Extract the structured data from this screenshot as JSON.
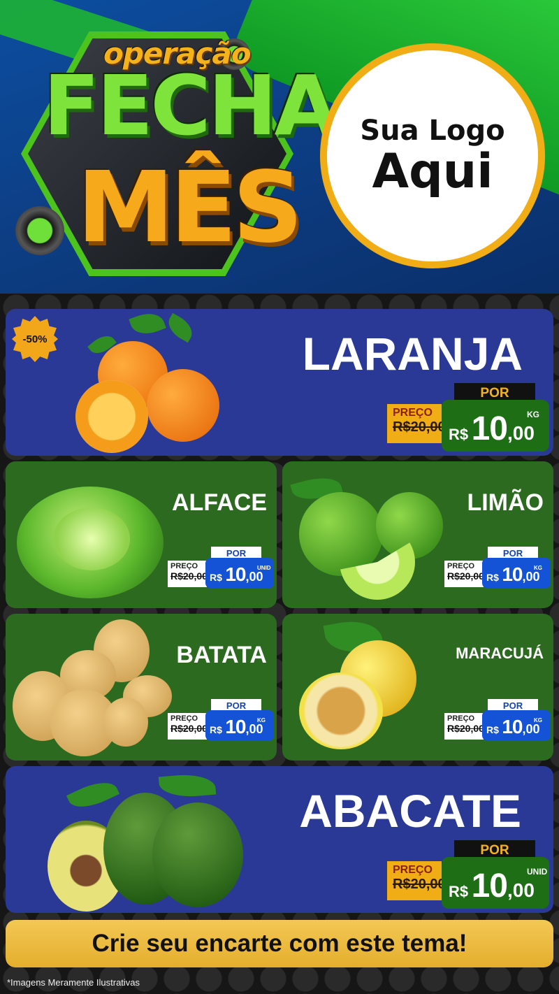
{
  "header": {
    "title_small": "operação",
    "title_line1": "FECHA",
    "title_line2": "MÊS",
    "logo_line1": "Sua Logo",
    "logo_line2": "Aqui"
  },
  "colors": {
    "blue_card": "#2a3896",
    "green_card": "#2c6a20",
    "gold": "#f1ad16",
    "price_blue": "#1453d6"
  },
  "discount_badge": "-50%",
  "products": {
    "laranja": {
      "name": "LARANJA",
      "por": "POR",
      "preco_label": "PREÇO",
      "old_price": "R$20,00",
      "currency": "R$",
      "price_int": "10",
      "price_cents": ",00",
      "unit": "KG"
    },
    "alface": {
      "name": "ALFACE",
      "por": "POR",
      "preco_label": "PREÇO",
      "old_price": "R$20,00",
      "currency": "R$",
      "price_int": "10",
      "price_cents": ",00",
      "unit": "UNID"
    },
    "limao": {
      "name": "LIMÃO",
      "por": "POR",
      "preco_label": "PREÇO",
      "old_price": "R$20,00",
      "currency": "R$",
      "price_int": "10",
      "price_cents": ",00",
      "unit": "KG"
    },
    "batata": {
      "name": "BATATA",
      "por": "POR",
      "preco_label": "PREÇO",
      "old_price": "R$20,00",
      "currency": "R$",
      "price_int": "10",
      "price_cents": ",00",
      "unit": "KG"
    },
    "maracuja": {
      "name": "MARACUJÁ",
      "por": "POR",
      "preco_label": "PREÇO",
      "old_price": "R$20,00",
      "currency": "R$",
      "price_int": "10",
      "price_cents": ",00",
      "unit": "KG"
    },
    "abacate": {
      "name": "ABACATE",
      "por": "POR",
      "preco_label": "PREÇO",
      "old_price": "R$20,00",
      "currency": "R$",
      "price_int": "10",
      "price_cents": ",00",
      "unit": "UNID"
    }
  },
  "cta": "Crie seu encarte com este tema!",
  "disclaimer": "*Imagens Meramente Ilustrativas"
}
